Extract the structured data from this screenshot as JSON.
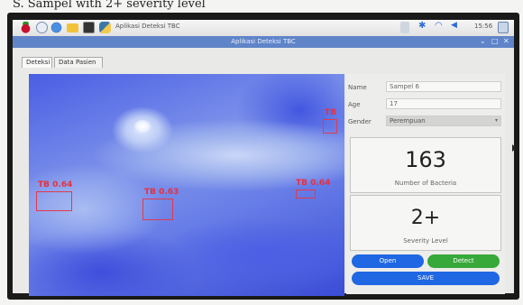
{
  "caption": "S. Sampel with 2+ severity level",
  "taskbar": {
    "window_title": "Aplikasi Deteksi TBC",
    "clock": "15:56",
    "icons": [
      "raspberry-icon",
      "wolfram-icon",
      "globe-icon",
      "folder-icon",
      "terminal-icon",
      "python-icon"
    ],
    "tray_icons": [
      "volume-icon",
      "bluetooth-icon",
      "wifi-icon",
      "speaker-icon"
    ]
  },
  "window": {
    "title": "Aplikasi Deteksi TBC",
    "controls": [
      "⌄",
      "□",
      "✕"
    ]
  },
  "tabs": [
    {
      "label": "Deteksi",
      "active": true
    },
    {
      "label": "Data Pasien",
      "active": false
    }
  ],
  "detections": [
    {
      "label": "TB 0.64"
    },
    {
      "label": "TB 0.63"
    },
    {
      "label": "TB 0.64"
    },
    {
      "label": "TB"
    }
  ],
  "form": {
    "name_label": "Name",
    "name_value": "Sampel 6",
    "age_label": "Age",
    "age_value": "17",
    "gender_label": "Gender",
    "gender_value": "Perempuan"
  },
  "bacteria": {
    "count": "163",
    "label": "Number of Bacteria"
  },
  "severity": {
    "level": "2+",
    "label": "Severity Level"
  },
  "buttons": {
    "open": "Open",
    "detect": "Detect",
    "save": "SAVE"
  },
  "colors": {
    "titlebar": "#5f84c8",
    "detection_box": "#e23a4a",
    "button_blue": "#1f67e3",
    "button_green": "#37a83a"
  }
}
